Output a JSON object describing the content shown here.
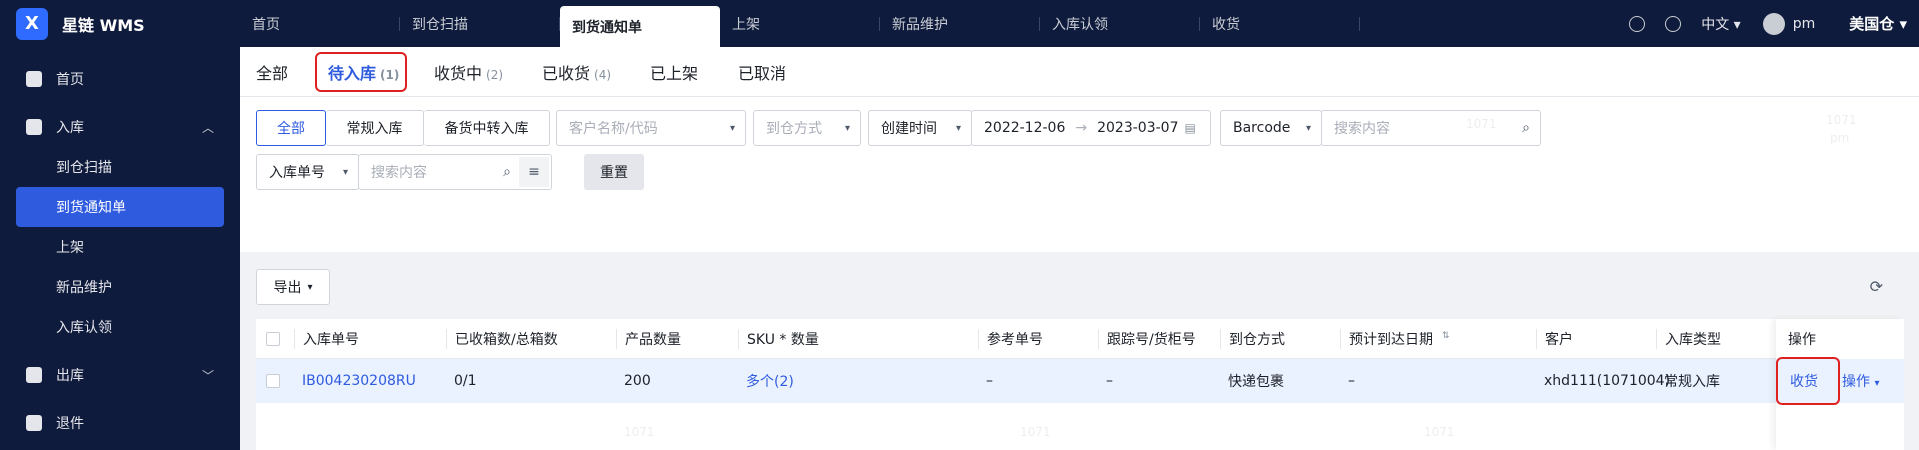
{
  "app": {
    "brand": "星链 WMS",
    "logo_glyph": "X",
    "accent": "#2f5bdf",
    "highlight": "#e02020"
  },
  "top_tabs": [
    {
      "label": "首页"
    },
    {
      "label": "到仓扫描"
    },
    {
      "label": "到货通知单"
    },
    {
      "label": "上架"
    },
    {
      "label": "新品维护"
    },
    {
      "label": "入库认领"
    },
    {
      "label": "收货"
    }
  ],
  "top_right": {
    "lang": "中文",
    "user": "pm",
    "warehouse": "美国仓"
  },
  "sidebar": {
    "home": "首页",
    "inbound": "入库",
    "sub": [
      "到仓扫描",
      "到货通知单",
      "上架",
      "新品维护",
      "入库认领"
    ],
    "outbound": "出库",
    "returns": "退件"
  },
  "status_tabs": [
    {
      "label": "全部",
      "count": ""
    },
    {
      "label": "待入库",
      "count": "(1)"
    },
    {
      "label": "收货中",
      "count": "(2)"
    },
    {
      "label": "已收货",
      "count": "(4)"
    },
    {
      "label": "已上架",
      "count": ""
    },
    {
      "label": "已取消",
      "count": ""
    }
  ],
  "filters": {
    "seg": [
      "全部",
      "常规入库",
      "备货中转入库"
    ],
    "customer_ph": "客户名称/代码",
    "arrival_ph": "到仓方式",
    "date_type": "创建时间",
    "date_from": "2022-12-06",
    "date_to": "2023-03-07",
    "barcode": "Barcode",
    "search_ph": "搜索内容",
    "order_no": "入库单号",
    "search_ph2": "搜索内容",
    "reset": "重置"
  },
  "toolbar": {
    "export": "导出"
  },
  "table": {
    "headers": [
      "入库单号",
      "已收箱数/总箱数",
      "产品数量",
      "SKU * 数量",
      "参考单号",
      "跟踪号/货柜号",
      "到仓方式",
      "预计到达日期",
      "客户",
      "入库类型",
      "操作"
    ],
    "rows": [
      {
        "order": "IB004230208RU",
        "boxes": "0/1",
        "qty": "200",
        "sku": "多个(2)",
        "ref": "–",
        "track": "–",
        "arrival": "快递包裹",
        "eta": "–",
        "customer": "xhd111(1071004)",
        "type": "常规入库",
        "receive": "收货",
        "ops": "操作"
      }
    ]
  },
  "watermark": [
    "1071",
    "pm"
  ]
}
